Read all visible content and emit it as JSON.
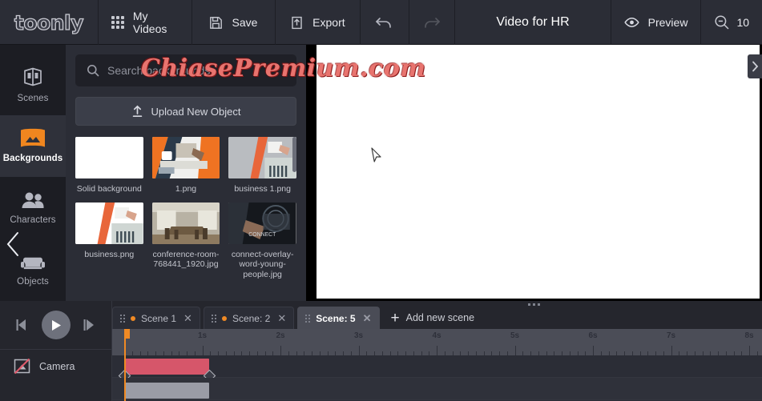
{
  "app": {
    "logo": "toonly",
    "watermark": "ChiasePremium.com"
  },
  "topbar": {
    "my_videos": "My Videos",
    "save": "Save",
    "export": "Export",
    "title": "Video for HR",
    "preview": "Preview",
    "zoom_level": "10"
  },
  "sidebar": {
    "items": [
      {
        "label": "Scenes",
        "icon": "scenes-icon",
        "active": false
      },
      {
        "label": "Backgrounds",
        "icon": "backgrounds-icon",
        "active": true
      },
      {
        "label": "Characters",
        "icon": "characters-icon",
        "active": false
      },
      {
        "label": "Objects",
        "icon": "objects-icon",
        "active": false
      }
    ]
  },
  "library": {
    "search_placeholder": "Search backgrounds",
    "search_value": "",
    "upload_label": "Upload New Object",
    "thumbnails": [
      {
        "label": "Solid background",
        "kind": "solid-white"
      },
      {
        "label": "1.png",
        "kind": "desk-orange"
      },
      {
        "label": "business 1.png",
        "kind": "business-grey"
      },
      {
        "label": "business.png",
        "kind": "business-white"
      },
      {
        "label": "conference-room-768441_1920.jpg",
        "kind": "conference-room"
      },
      {
        "label": "connect-overlay-word-young-people.jpg",
        "kind": "connect-overlay"
      }
    ]
  },
  "timeline": {
    "scenes": [
      {
        "label": "Scene 1",
        "active": false,
        "dot": true
      },
      {
        "label": "Scene: 2",
        "active": false,
        "dot": true
      },
      {
        "label": "Scene: 5",
        "active": true,
        "dot": false
      }
    ],
    "add_scene_label": "Add new scene",
    "ruler_labels": [
      "1s",
      "2s",
      "3s",
      "4s",
      "5s",
      "6s",
      "7s",
      "8s"
    ],
    "tracks": [
      {
        "label": "Camera",
        "icon": "camera-off-icon"
      }
    ]
  }
}
